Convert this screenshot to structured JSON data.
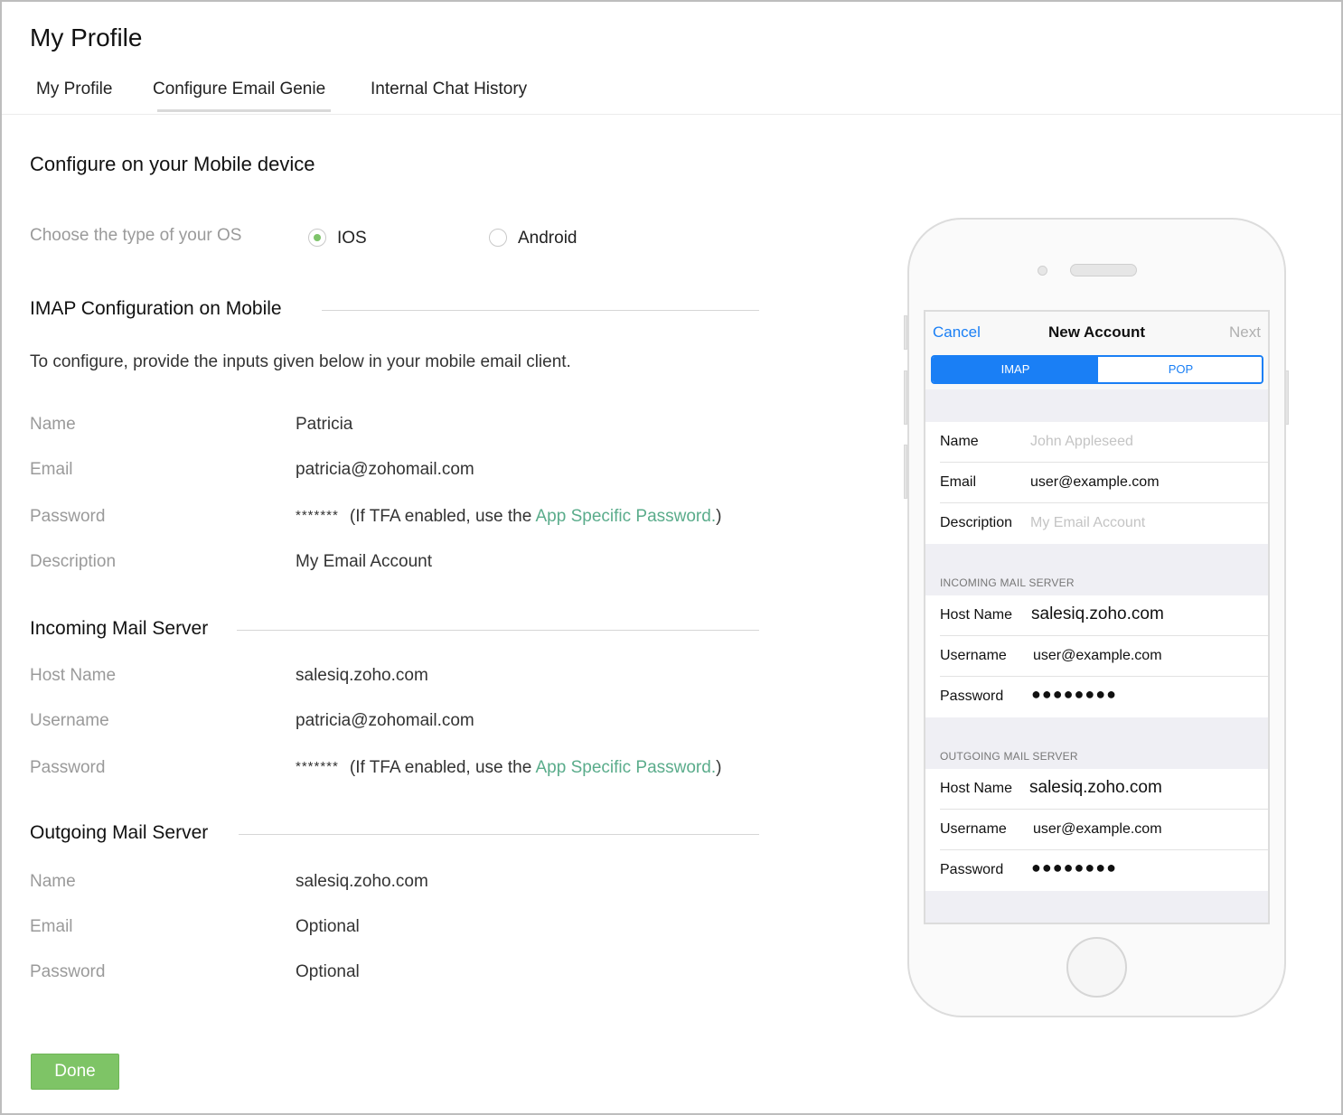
{
  "page": {
    "title": "My Profile"
  },
  "tabs": [
    {
      "label": "My Profile"
    },
    {
      "label": "Configure Email Genie",
      "active": true
    },
    {
      "label": "Internal Chat History"
    }
  ],
  "section_title": "Configure on your Mobile device",
  "os": {
    "label": "Choose the type of your OS",
    "options": [
      {
        "label": "IOS",
        "selected": true
      },
      {
        "label": "Android",
        "selected": false
      }
    ]
  },
  "imap": {
    "heading": "IMAP Configuration on Mobile",
    "intro": "To configure, provide the inputs given below in your mobile email client.",
    "fields": [
      {
        "label": "Name",
        "value": "Patricia"
      },
      {
        "label": "Email",
        "value": "patricia@zohomail.com"
      },
      {
        "label": "Password",
        "value": "*******",
        "note_pre": "(If TFA enabled, use the ",
        "link": "App Specific Password.",
        "note_post": ")"
      },
      {
        "label": "Description",
        "value": "My Email Account"
      }
    ]
  },
  "incoming": {
    "heading": "Incoming Mail Server",
    "fields": [
      {
        "label": "Host Name",
        "value": "salesiq.zoho.com"
      },
      {
        "label": "Username",
        "value": "patricia@zohomail.com"
      },
      {
        "label": "Password",
        "value": "*******",
        "note_pre": "(If TFA enabled, use the ",
        "link": "App Specific Password.",
        "note_post": ")"
      }
    ]
  },
  "outgoing": {
    "heading": "Outgoing Mail Server",
    "fields": [
      {
        "label": "Name",
        "value": "salesiq.zoho.com"
      },
      {
        "label": "Email",
        "value": "Optional"
      },
      {
        "label": "Password",
        "value": "Optional"
      }
    ]
  },
  "done_label": "Done",
  "phone": {
    "nav": {
      "cancel": "Cancel",
      "title": "New Account",
      "next": "Next"
    },
    "segments": [
      "IMAP",
      "POP"
    ],
    "account": [
      {
        "label": "Name",
        "value": "John Appleseed",
        "placeholder": true
      },
      {
        "label": "Email",
        "value": "user@example.com"
      },
      {
        "label": "Description",
        "value": "My Email Account",
        "placeholder": true
      }
    ],
    "incoming_head": "INCOMING MAIL SERVER",
    "incoming": [
      {
        "label": "Host Name",
        "value": "salesiq.zoho.com"
      },
      {
        "label": "Username",
        "value": "user@example.com"
      },
      {
        "label": "Password",
        "value": "●●●●●●●●"
      }
    ],
    "outgoing_head": "OUTGOING MAIL SERVER",
    "outgoing": [
      {
        "label": "Host Name",
        "value": "salesiq.zoho.com"
      },
      {
        "label": "Username",
        "value": "user@example.com"
      },
      {
        "label": "Password",
        "value": "●●●●●●●●"
      }
    ]
  },
  "colors": {
    "accent_green": "#7ec466",
    "link_green": "#5aac8b",
    "ios_blue": "#1a7ff5"
  }
}
